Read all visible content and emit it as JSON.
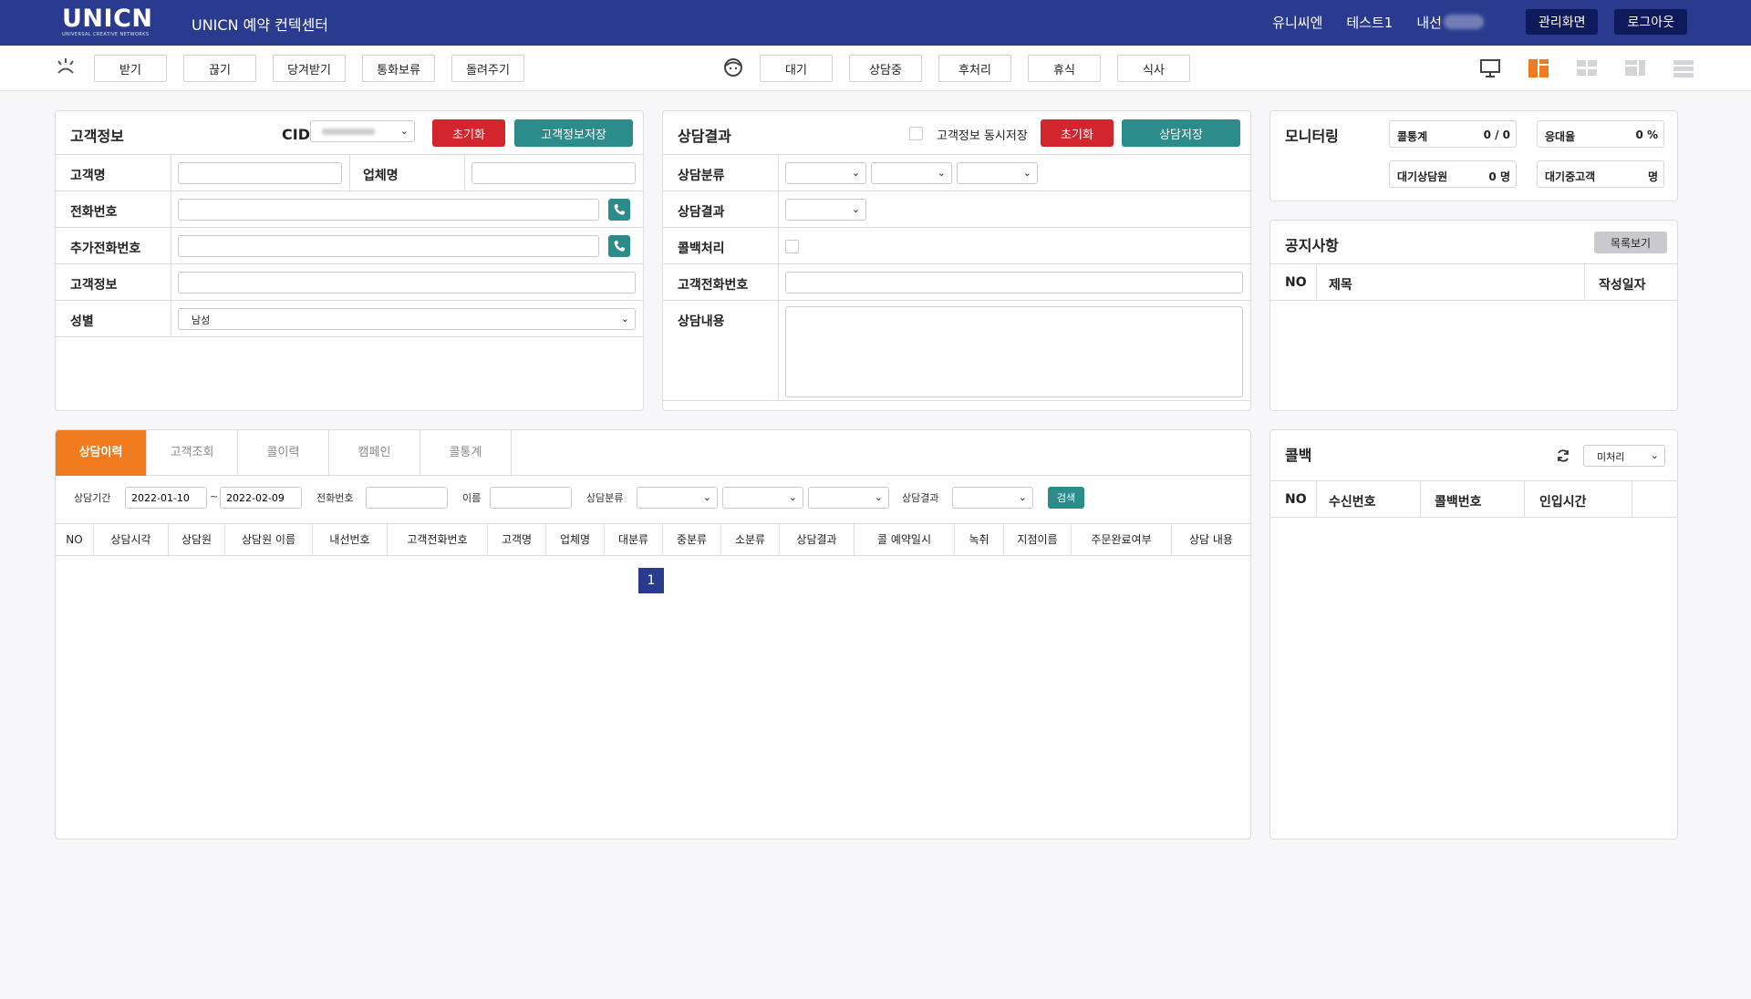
{
  "header": {
    "logo": "UNICN",
    "logo_sub": "UNIVERSAL CREATIVE NETWORKS",
    "title": "UNICN 예약 컨텍센터",
    "company": "유니씨엔",
    "user": "테스트1",
    "extension_label": "내선",
    "admin_btn": "관리화면",
    "logout_btn": "로그아웃"
  },
  "toolbar": {
    "call_buttons": [
      "받기",
      "끊기",
      "당겨받기",
      "통화보류",
      "돌려주기"
    ],
    "status_buttons": [
      "대기",
      "상담중",
      "후처리",
      "휴식",
      "식사"
    ]
  },
  "customer": {
    "title": "고객정보",
    "cid_label": "CID",
    "reset_btn": "초기화",
    "save_btn": "고객정보저장",
    "name_label": "고객명",
    "company_label": "업체명",
    "phone_label": "전화번호",
    "extra_phone_label": "추가전화번호",
    "info_label": "고객정보",
    "gender_label": "성별",
    "gender_value": "남성"
  },
  "consult": {
    "title": "상담결과",
    "sync_save_label": "고객정보 동시저장",
    "reset_btn": "초기화",
    "save_btn": "상담저장",
    "category_label": "상담분류",
    "result_label": "상담결과",
    "callback_label": "콜백처리",
    "customer_phone_label": "고객전화번호",
    "content_label": "상담내용"
  },
  "monitoring": {
    "title": "모니터링",
    "cards": [
      {
        "label": "콜통계",
        "value": "0 / 0"
      },
      {
        "label": "응대율",
        "value": "0 %"
      },
      {
        "label": "대기상담원",
        "value": "0 명"
      },
      {
        "label": "대기중고객",
        "value": "명"
      }
    ]
  },
  "notice": {
    "title": "공지사항",
    "list_btn": "목록보기",
    "columns": [
      "NO",
      "제목",
      "작성일자"
    ]
  },
  "history": {
    "tabs": [
      "상담이력",
      "고객조회",
      "콜이력",
      "캠페인",
      "콜통계"
    ],
    "period_label": "상담기간",
    "date_from": "2022-01-10",
    "date_sep": "~",
    "date_to": "2022-02-09",
    "phone_label": "전화번호",
    "name_label": "이름",
    "category_label": "상담분류",
    "result_label": "상담결과",
    "search_btn": "검색",
    "columns": [
      "NO",
      "상담시각",
      "상담원",
      "상담원 이름",
      "내선번호",
      "고객전화번호",
      "고객명",
      "업체명",
      "대분류",
      "중분류",
      "소분류",
      "상담결과",
      "콜 예약일시",
      "녹취",
      "지점이름",
      "주문완료여부",
      "상담 내용"
    ],
    "page": "1"
  },
  "callback": {
    "title": "콜백",
    "filter_value": "미처리",
    "columns": [
      "NO",
      "수신번호",
      "콜백번호",
      "인입시간"
    ]
  },
  "colors": {
    "header_bg": "#2a3a8f",
    "accent_orange": "#f07b1e",
    "btn_red": "#d3252d",
    "btn_teal": "#2c8c8c"
  }
}
